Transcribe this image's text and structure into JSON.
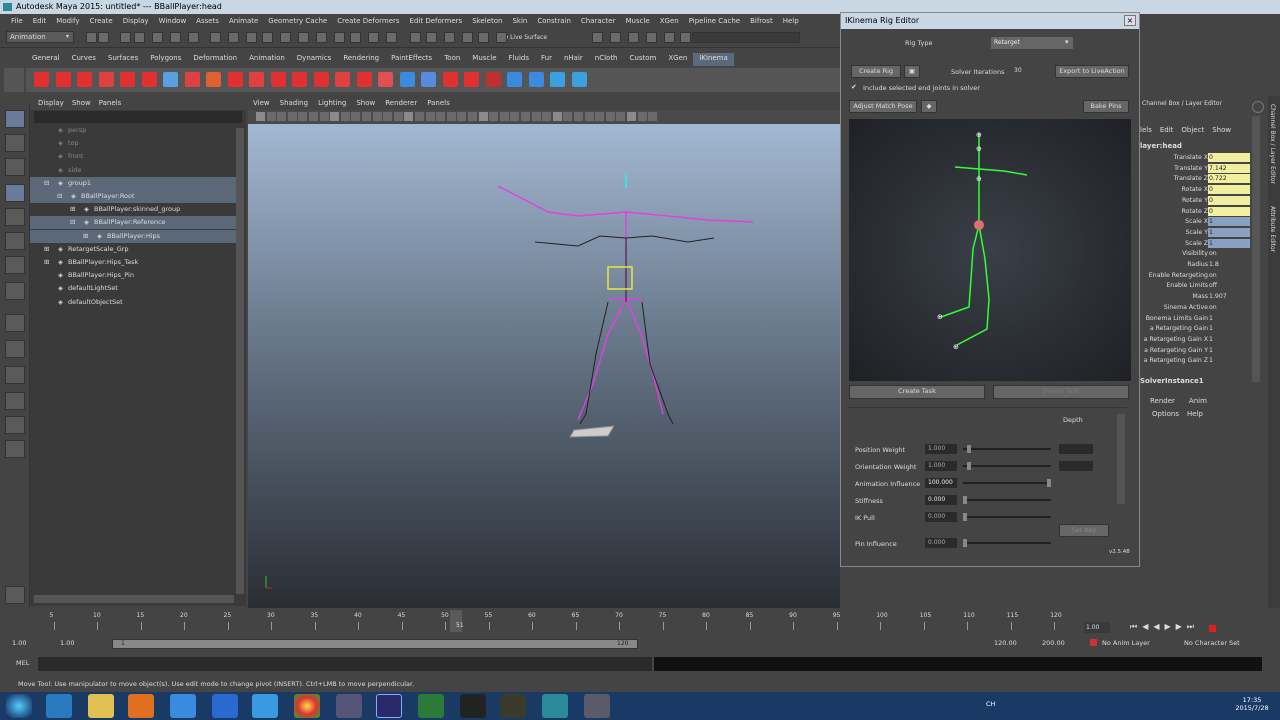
{
  "window_title": "Autodesk Maya 2015: untitled*   ---   BBallPlayer:head",
  "menu": [
    "File",
    "Edit",
    "Modify",
    "Create",
    "Display",
    "Window",
    "Assets",
    "Animate",
    "Geometry Cache",
    "Create Deformers",
    "Edit Deformers",
    "Skeleton",
    "Skin",
    "Constrain",
    "Character",
    "Muscle",
    "XGen",
    "Pipeline Cache",
    "Bifrost",
    "Help"
  ],
  "mode_selector": "Animation",
  "no_live_surface": "No Live Surface",
  "shelf_tabs": [
    "General",
    "Curves",
    "Surfaces",
    "Polygons",
    "Deformation",
    "Animation",
    "Dynamics",
    "Rendering",
    "PaintEffects",
    "Toon",
    "Muscle",
    "Fluids",
    "Fur",
    "nHair",
    "nCloth",
    "Custom",
    "XGen",
    "IKinema"
  ],
  "shelf_active": "IKinema",
  "outliner": {
    "menu": [
      "Display",
      "Show",
      "Panels"
    ],
    "items": [
      {
        "label": "persp",
        "indent": 1,
        "expand": "",
        "sel": false,
        "dim": true
      },
      {
        "label": "top",
        "indent": 1,
        "expand": "",
        "sel": false,
        "dim": true
      },
      {
        "label": "front",
        "indent": 1,
        "expand": "",
        "sel": false,
        "dim": true
      },
      {
        "label": "side",
        "indent": 1,
        "expand": "",
        "sel": false,
        "dim": true
      },
      {
        "label": "group1",
        "indent": 1,
        "expand": "−",
        "sel": true,
        "dim": false
      },
      {
        "label": "BBallPlayer:Root",
        "indent": 2,
        "expand": "−",
        "sel": true,
        "dim": false
      },
      {
        "label": "BBallPlayer:skinned_group",
        "indent": 3,
        "expand": "+",
        "sel": false,
        "dim": false
      },
      {
        "label": "BBallPlayer:Reference",
        "indent": 3,
        "expand": "−",
        "sel": true,
        "dim": false
      },
      {
        "label": "BBallPlayer:Hips",
        "indent": 4,
        "expand": "+",
        "sel": true,
        "dim": false
      },
      {
        "label": "RetargetScale_Grp",
        "indent": 1,
        "expand": "+",
        "sel": false,
        "dim": false
      },
      {
        "label": "BBallPlayer:Hips_Task",
        "indent": 1,
        "expand": "+",
        "sel": false,
        "dim": false
      },
      {
        "label": "BBallPlayer:Hips_Pin",
        "indent": 1,
        "expand": "",
        "sel": false,
        "dim": false
      },
      {
        "label": "defaultLightSet",
        "indent": 1,
        "expand": "",
        "sel": false,
        "dim": false
      },
      {
        "label": "defaultObjectSet",
        "indent": 1,
        "expand": "",
        "sel": false,
        "dim": false
      }
    ]
  },
  "viewport": {
    "menu": [
      "View",
      "Shading",
      "Lighting",
      "Show",
      "Renderer",
      "Panels"
    ]
  },
  "rig_editor": {
    "title": "IKinema Rig Editor",
    "rig_type_label": "Rig Type",
    "rig_type_value": "Retarget",
    "create_rig": "Create Rig",
    "solver_iterations_label": "Solver Iterations",
    "solver_iterations_value": "30",
    "export_label": "Export to LiveAction",
    "include_end_joints": "Include selected end joints in solver",
    "adjust_match_pose": "Adjust Match Pose",
    "bake_pins": "Bake Pins",
    "create_task": "Create Task",
    "delete_task": "Delete Task",
    "depth_label": "Depth",
    "params": [
      {
        "label": "Position Weight",
        "value": "1.000",
        "fill": 0.05
      },
      {
        "label": "Orientation Weight",
        "value": "1.000",
        "fill": 0.05
      },
      {
        "label": "Animation Influence",
        "value": "100.000",
        "fill": 1.0
      },
      {
        "label": "Stiffness",
        "value": "0.000",
        "fill": 0.0
      },
      {
        "label": "IK Pull",
        "value": "0.000",
        "fill": 0.0
      },
      {
        "label": "Pin Influence",
        "value": "0.000",
        "fill": 0.0
      }
    ],
    "set_key": "Set Key",
    "version": "v2.5.48"
  },
  "channel_box": {
    "header": "Channel Box / Layer Editor",
    "menu": [
      "lels",
      "Edit",
      "Object",
      "Show"
    ],
    "object": "layer:head",
    "channels": [
      {
        "label": "Translate X",
        "value": "0",
        "color": "y"
      },
      {
        "label": "Translate Y",
        "value": "7.142",
        "color": "y"
      },
      {
        "label": "Translate Z",
        "value": "0.722",
        "color": "y"
      },
      {
        "label": "Rotate X",
        "value": "0",
        "color": "y"
      },
      {
        "label": "Rotate Y",
        "value": "0",
        "color": "y"
      },
      {
        "label": "Rotate Z",
        "value": "0",
        "color": "y"
      },
      {
        "label": "Scale X",
        "value": "1",
        "color": "g"
      },
      {
        "label": "Scale Y",
        "value": "1",
        "color": "g"
      },
      {
        "label": "Scale Z",
        "value": "1",
        "color": "g"
      },
      {
        "label": "Visibility",
        "value": "on",
        "color": "d"
      },
      {
        "label": "Radius",
        "value": "1.8",
        "color": "d"
      },
      {
        "label": "Enable Retargeting",
        "value": "on",
        "color": "d"
      },
      {
        "label": "Enable Limits",
        "value": "off",
        "color": "d"
      },
      {
        "label": "Mass",
        "value": "1.907",
        "color": "d"
      },
      {
        "label": "Sinema Active",
        "value": "on",
        "color": "d"
      },
      {
        "label": "Bonema Limits Gain",
        "value": "1",
        "color": "d"
      },
      {
        "label": "a Retargeting Gain",
        "value": "1",
        "color": "d"
      },
      {
        "label": "a Retargeting Gain X",
        "value": "1",
        "color": "d"
      },
      {
        "label": "a Retargeting Gain Y",
        "value": "1",
        "color": "d"
      },
      {
        "label": "a Retargeting Gain Z",
        "value": "1",
        "color": "d"
      }
    ],
    "section": "SolverInstance1",
    "layer_tabs": [
      "Render",
      "Anim"
    ],
    "layer_menu": [
      "Options",
      "Help"
    ],
    "side_tabs": [
      "Channel Box / Layer Editor",
      "Attribute Editor"
    ]
  },
  "timeline": {
    "ticks": [
      "5",
      "10",
      "15",
      "20",
      "25",
      "30",
      "35",
      "40",
      "45",
      "50",
      "55",
      "60",
      "65",
      "70",
      "75",
      "80",
      "85",
      "90",
      "95",
      "100",
      "105",
      "110",
      "115",
      "120"
    ],
    "current_frame": "51",
    "current_frame_box": "1.00"
  },
  "range": {
    "start": "1.00",
    "start2": "1.00",
    "range_start": "1",
    "range_end": "120",
    "end": "120.00",
    "end2": "200.00",
    "anim_layer": "No Anim Layer",
    "char_set": "No Character Set"
  },
  "cmd_label": "MEL",
  "help_line": "Move Tool: Use manipulator to move object(s). Use edit mode to change pivot (INSERT). Ctrl+LMB to move perpendicular.",
  "taskbar": {
    "lang": "CH",
    "time": "17:35",
    "date": "2015/7/28"
  }
}
